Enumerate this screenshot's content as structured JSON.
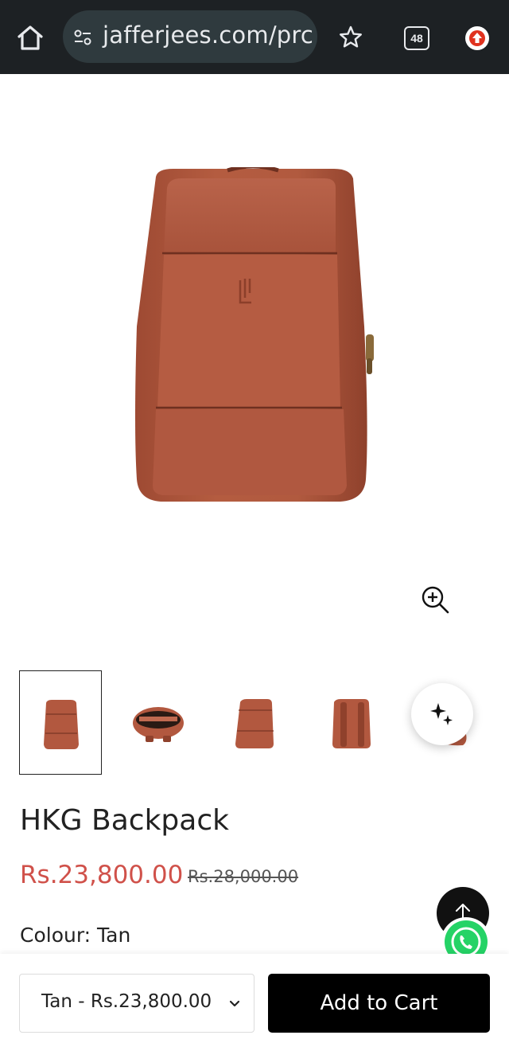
{
  "browser": {
    "url": "jafferjees.com/prc",
    "tab_count": "48",
    "icons": [
      "home-icon",
      "site-info-icon",
      "bookmark-star-icon",
      "tab-switcher-icon",
      "update-icon"
    ]
  },
  "gallery": {
    "zoom_icon": "zoom-in-icon",
    "thumbnails": [
      "front",
      "top-open",
      "side",
      "back",
      "partial"
    ],
    "selected_index": 0
  },
  "product": {
    "title": "HKG Backpack",
    "price": "Rs.23,800.00",
    "compare_price": "Rs.28,000.00",
    "colour_label": "Colour: Tan"
  },
  "bottom_bar": {
    "variant_label": "Tan - Rs.23,800.00",
    "add_to_cart_label": "Add to Cart"
  },
  "colors": {
    "browser_bar": "#1d2124",
    "url_pill": "#2f3a3e",
    "sale_price": "#d0514a",
    "leather": "#b2583f",
    "button": "#000000",
    "whatsapp": "#25d366"
  }
}
